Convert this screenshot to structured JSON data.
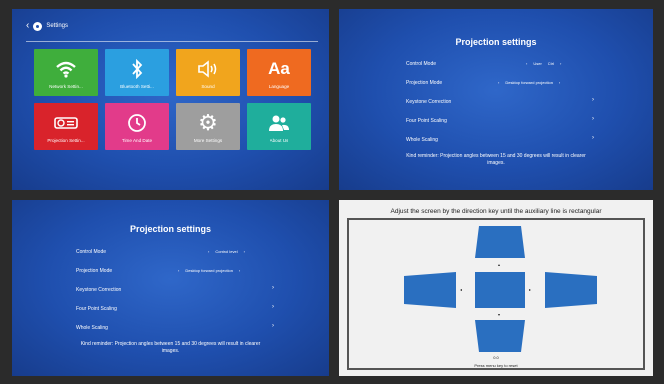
{
  "settings": {
    "title": "Settings",
    "back_icon": "arrow-left-icon",
    "tiles": [
      {
        "label": "Network Settin...",
        "icon": "wifi-icon",
        "glyph": "◠"
      },
      {
        "label": "Bluetooth Setti...",
        "icon": "bluetooth-icon",
        "glyph": "ᛒ"
      },
      {
        "label": "Sound",
        "icon": "speaker-icon",
        "glyph": "🔈"
      },
      {
        "label": "Language",
        "icon": "language-icon",
        "glyph": "Aa"
      },
      {
        "label": "Projection Settin...",
        "icon": "projector-icon",
        "glyph": "▭"
      },
      {
        "label": "Time And Date",
        "icon": "clock-icon",
        "glyph": "◷"
      },
      {
        "label": "More Settings",
        "icon": "gear-icon",
        "glyph": "⚙"
      },
      {
        "label": "About Us",
        "icon": "people-icon",
        "glyph": "👥"
      }
    ]
  },
  "projection_a": {
    "title": "Projection settings",
    "rows": [
      {
        "label": "Control Mode",
        "value1": "User",
        "value2": "Ctrl"
      },
      {
        "label": "Projection Mode",
        "value1": "Desktop forward projection",
        "value2": ""
      },
      {
        "label": "Keystone Correction",
        "value1": "",
        "value2": ""
      },
      {
        "label": "Four Point Scaling",
        "value1": "",
        "value2": ""
      },
      {
        "label": "Whole Scaling",
        "value1": "",
        "value2": ""
      }
    ],
    "note": "Kind reminder: Projection angles between 15 and 30 degrees will result in clearer images."
  },
  "projection_b": {
    "title": "Projection settings",
    "rows": [
      {
        "label": "Control Mode",
        "value1": "Control level",
        "value2": ""
      },
      {
        "label": "Projection Mode",
        "value1": "Desktop forward projection",
        "value2": ""
      },
      {
        "label": "Keystone Correction",
        "value1": "",
        "value2": ""
      },
      {
        "label": "Four Point Scaling",
        "value1": "",
        "value2": ""
      },
      {
        "label": "Whole Scaling",
        "value1": "",
        "value2": ""
      }
    ],
    "note": "Kind reminder: Projection angles between 15 and 30 degrees will result in clearer images."
  },
  "keystone": {
    "title": "Adjust the screen by the direction key until the auxiliary line is rectangular",
    "value": "0.0",
    "hint": "Press menu key to reset"
  },
  "colors": {
    "blue_bg": "#1f4fae",
    "keystone_blue": "#2a6fc0"
  }
}
